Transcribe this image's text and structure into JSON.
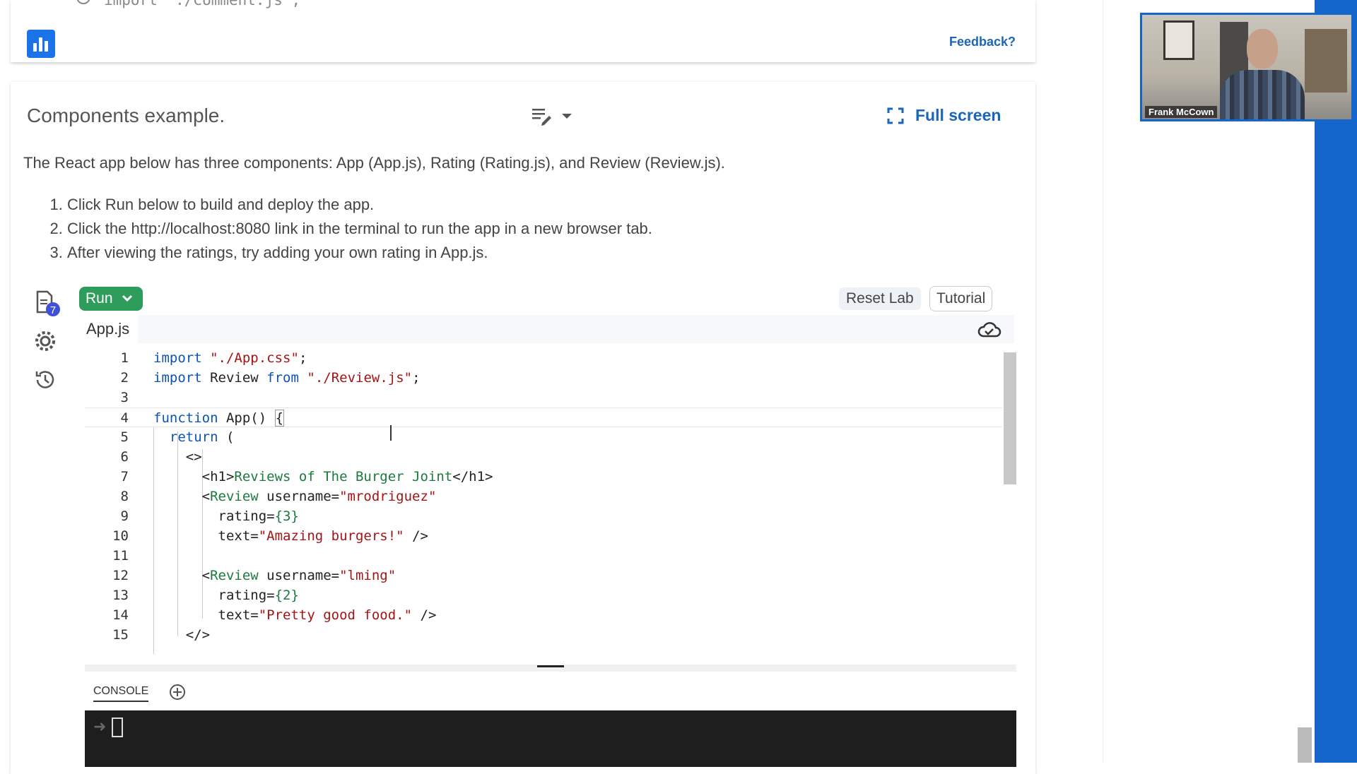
{
  "top_card": {
    "partial_text": "import \"./Comment.js\";",
    "feedback_label": "Feedback?"
  },
  "activity": {
    "title": "Components example.",
    "fullscreen_label": "Full screen",
    "description": "The React app below has three components: App (App.js), Rating (Rating.js), and Review (Review.js).",
    "steps": [
      "Click Run below to build and deploy the app.",
      "Click the http://localhost:8080 link in the terminal to run the app in a new browser tab.",
      "After viewing the ratings, try adding your own rating in App.js."
    ]
  },
  "ide": {
    "files_badge": "7",
    "run_label": "Run",
    "reset_label": "Reset Lab",
    "tutorial_label": "Tutorial",
    "active_tab": "App.js",
    "line_numbers": [
      "1",
      "2",
      "3",
      "4",
      "5",
      "6",
      "7",
      "8",
      "9",
      "10",
      "11",
      "12",
      "13",
      "14",
      "15"
    ],
    "console_tab": "CONSOLE"
  },
  "video": {
    "participant_name": "Frank McCown"
  },
  "colors": {
    "accent_blue": "#1466cc",
    "run_green": "#2e9c5b",
    "link_blue": "#1a66b8"
  }
}
